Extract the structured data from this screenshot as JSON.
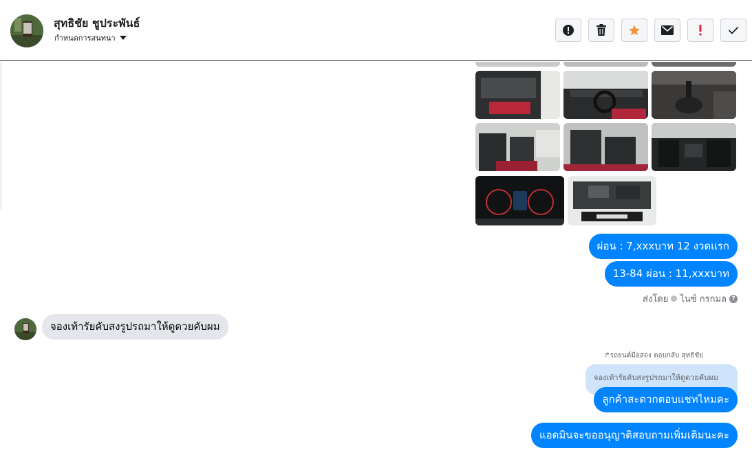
{
  "header": {
    "contact_name": "สุทธิชัย ชูประพันธ์",
    "assign_label": "กำหนดการสนทนา",
    "toolbar": [
      {
        "name": "exclamation-circle-icon"
      },
      {
        "name": "trash-icon"
      },
      {
        "name": "star-icon"
      },
      {
        "name": "envelope-icon"
      },
      {
        "name": "important-icon"
      },
      {
        "name": "checkmark-icon"
      }
    ]
  },
  "photos": {
    "top_partial": 3,
    "grid_rows": 2,
    "grid_cols": 3,
    "bottom_count": 2
  },
  "messages": {
    "out1": "ผ่อน : 7,xxxบาท 12 งวดแรก",
    "out2": "13-84 ผ่อน : 11,xxxบาท",
    "sent_by": "ส่งโดย",
    "sender": "ไนซ์ กรกมล",
    "incoming": "จองเท้ารัยคับสงรูปรถมาให้ดูดวยคับผม",
    "reply_label": "รถยนต์มือสอง ตอบกลับ สุทธิชัย",
    "quoted": "จองเท้ารัยคับสงรูปรถมาให้ดูดวยคับผม",
    "out3": "ลูกค้าสะดวกตอบแชทไหมคะ",
    "out4": "แอดมินจะขออนุญาติสอบถามเพิ่มเติมนะคะ"
  },
  "colors": {
    "bubble_out": "#0084ff",
    "bubble_in": "#e4e6eb",
    "star": "#f7923a",
    "important": "#e41e3f"
  }
}
